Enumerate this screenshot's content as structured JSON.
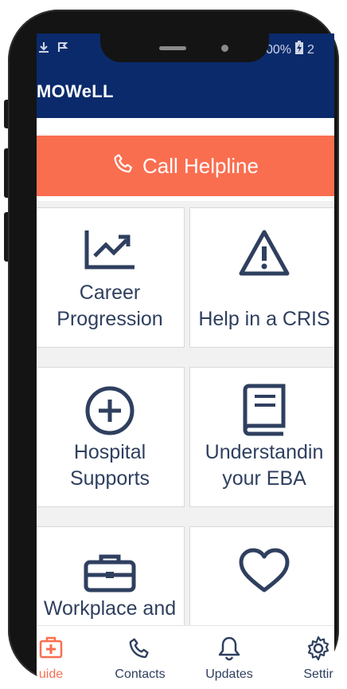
{
  "status": {
    "battery_text": "00%",
    "right_partial": "2"
  },
  "app": {
    "title": "MOWeLL"
  },
  "helpline": {
    "label": "Call Helpline"
  },
  "tiles": [
    {
      "label_lines": [
        "Career",
        "Progression"
      ],
      "icon": "trend-chart-icon"
    },
    {
      "label_lines": [
        "Help in a CRIS"
      ],
      "icon": "warning-triangle-icon"
    },
    {
      "label_lines": [
        "Hospital",
        "Supports"
      ],
      "icon": "plus-circle-icon"
    },
    {
      "label_lines": [
        "Understandin",
        "your EBA"
      ],
      "icon": "book-icon"
    },
    {
      "label_lines": [
        "Workplace and"
      ],
      "icon": "briefcase-icon"
    },
    {
      "label_lines": [],
      "icon": "heart-icon"
    }
  ],
  "nav": {
    "guide": "uide",
    "contacts": "Contacts",
    "updates": "Updates",
    "settings": "Settir"
  },
  "colors": {
    "primary": "#0a2a6b",
    "accent": "#fa6e50",
    "icon": "#2f3f5f"
  }
}
